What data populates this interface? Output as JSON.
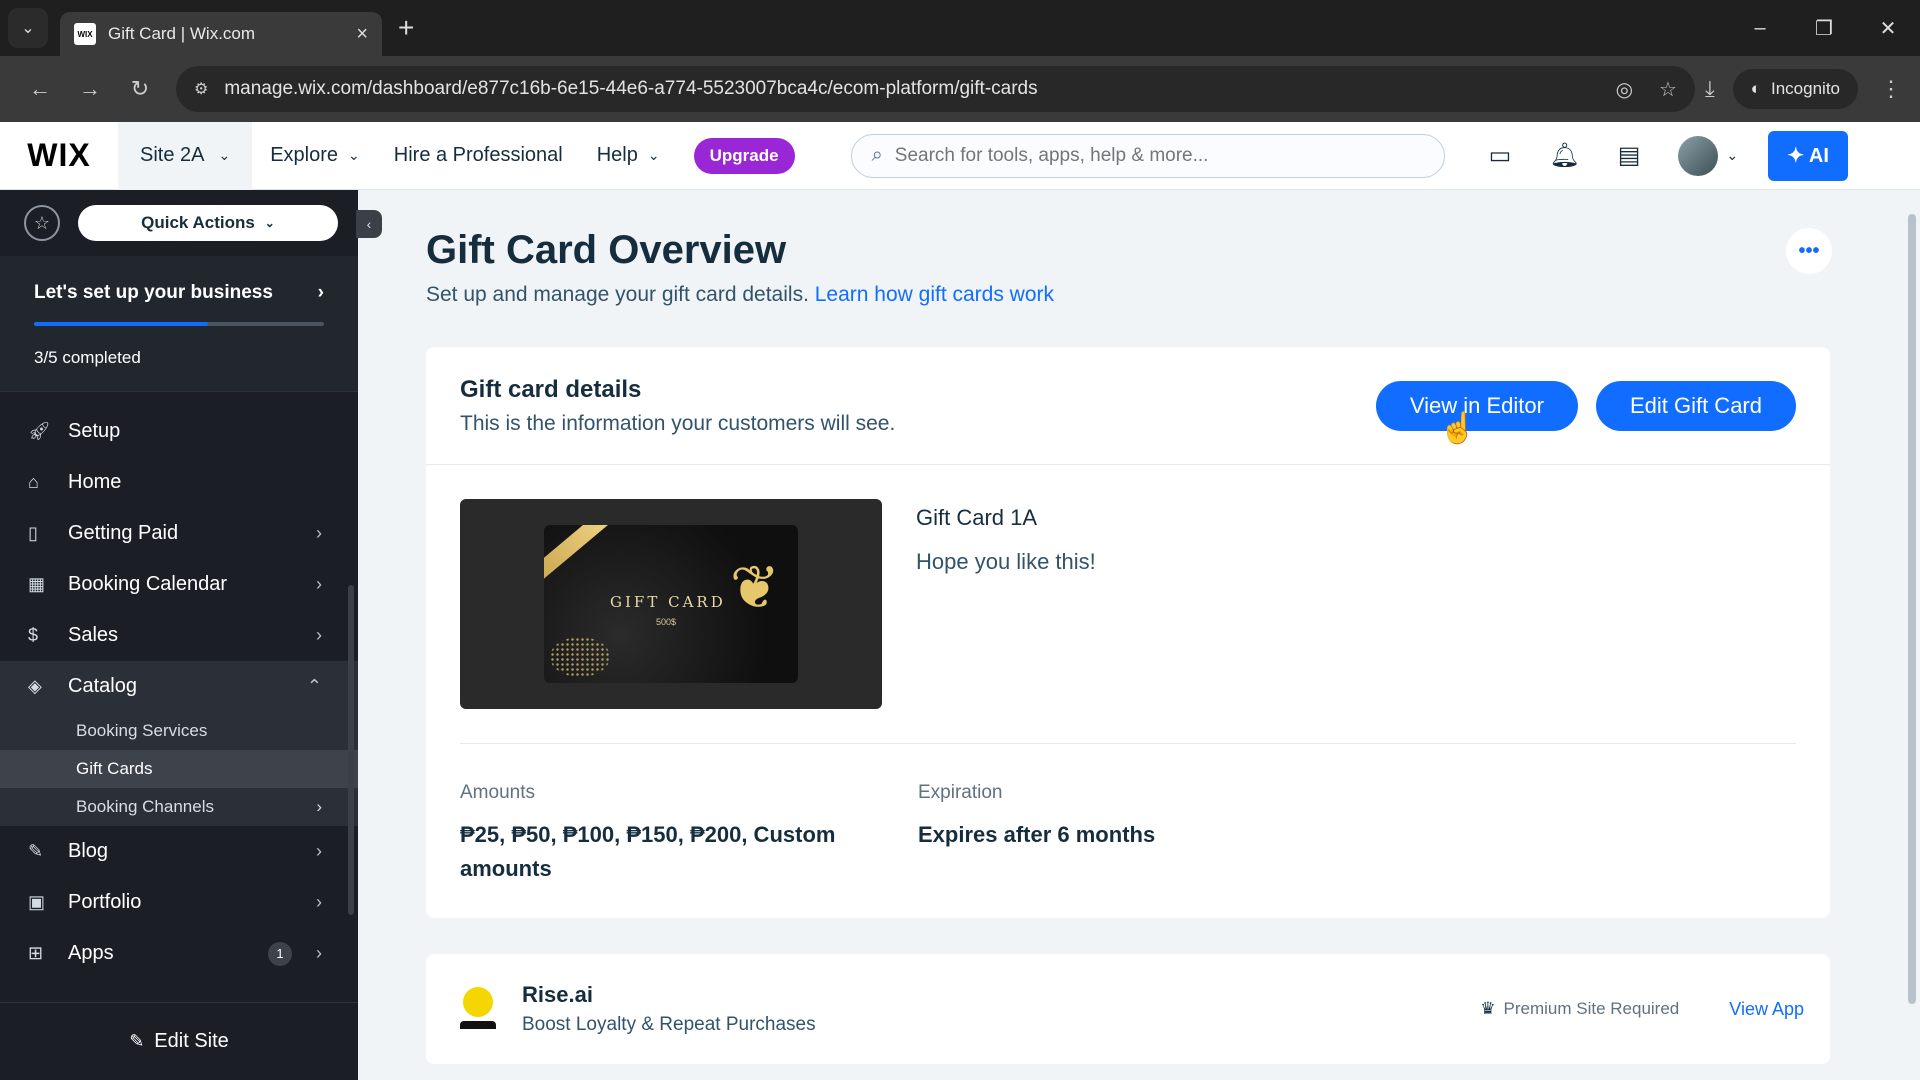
{
  "browser": {
    "tab_title": "Gift Card | Wix.com",
    "favicon_text": "WIX",
    "url": "manage.wix.com/dashboard/e877c16b-6e15-44e6-a774-5523007bca4c/ecom-platform/gift-cards",
    "incognito_label": "Incognito"
  },
  "topbar": {
    "logo": "WIX",
    "site_name": "Site 2A",
    "nav": [
      "Explore",
      "Hire a Professional",
      "Help"
    ],
    "upgrade_label": "Upgrade",
    "search_placeholder": "Search for tools, apps, help & more...",
    "ai_label": "✦ AI"
  },
  "sidebar": {
    "quick_actions": "Quick Actions",
    "setup_title": "Let's set up your business",
    "setup_progress": 0.6,
    "setup_count": "3/5 completed",
    "items": [
      {
        "label": "Setup",
        "icon": "rocket-icon"
      },
      {
        "label": "Home",
        "icon": "home-icon"
      },
      {
        "label": "Getting Paid",
        "icon": "invoice-icon"
      },
      {
        "label": "Booking Calendar",
        "icon": "calendar-icon"
      },
      {
        "label": "Sales",
        "icon": "dollar-icon"
      },
      {
        "label": "Catalog",
        "icon": "tag-icon"
      },
      {
        "label": "Blog",
        "icon": "pen-nib-icon"
      },
      {
        "label": "Portfolio",
        "icon": "portfolio-icon"
      },
      {
        "label": "Apps",
        "icon": "apps-icon",
        "badge": "1"
      }
    ],
    "catalog_sub": [
      "Booking Services",
      "Gift Cards",
      "Booking Channels"
    ],
    "edit_site": "Edit Site"
  },
  "page": {
    "title": "Gift Card Overview",
    "subtitle": "Set up and manage your gift card details.",
    "learn_link": "Learn how gift cards work"
  },
  "details_card": {
    "title": "Gift card details",
    "description": "This is the information your customers will see.",
    "view_editor_label": "View in Editor",
    "edit_label": "Edit Gift Card",
    "image_text": "GIFT CARD",
    "image_amount": "500$",
    "card_name": "Gift Card 1A",
    "card_message": "Hope you like this!",
    "amounts_label": "Amounts",
    "amounts_value": "₱25, ₱50, ₱100, ₱150, ₱200, Custom amounts",
    "expiration_label": "Expiration",
    "expiration_value": "Expires after 6 months"
  },
  "app_card": {
    "name": "Rise.ai",
    "description": "Boost Loyalty & Repeat Purchases",
    "premium_label": "Premium Site Required",
    "view_app_label": "View App"
  }
}
